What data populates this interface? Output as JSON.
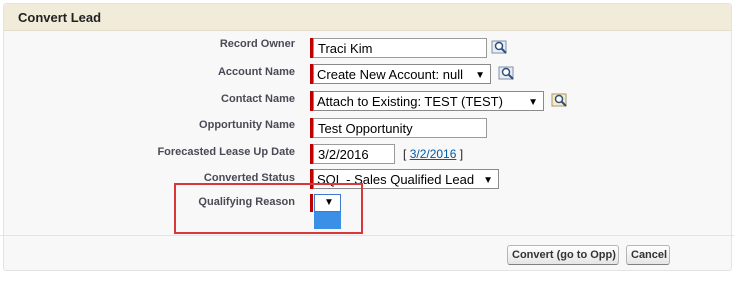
{
  "header": {
    "title": "Convert Lead"
  },
  "fields": {
    "record_owner": {
      "label": "Record Owner",
      "value": "Traci Kim"
    },
    "account_name": {
      "label": "Account Name",
      "value": "Create New Account: null"
    },
    "contact_name": {
      "label": "Contact Name",
      "value": "Attach to Existing: TEST (TEST)"
    },
    "opportunity_name": {
      "label": "Opportunity Name",
      "value": "Test Opportunity"
    },
    "forecasted_lease_up_date": {
      "label": "Forecasted Lease Up Date",
      "value": "3/2/2016",
      "link_open": "[",
      "link": "3/2/2016",
      "link_close": "]"
    },
    "converted_status": {
      "label": "Converted Status",
      "value": "SQL - Sales Qualified Lead"
    },
    "qualifying_reason": {
      "label": "Qualifying Reason",
      "value": ""
    }
  },
  "buttons": {
    "convert": "Convert (go to Opp)",
    "cancel": "Cancel"
  },
  "icons": {
    "lookup": "magnifier-lookup-icon",
    "dropdown": "chevron-down-icon"
  },
  "colors": {
    "required": "#c00000",
    "highlight": "#d9383a",
    "selection": "#3c8fe6",
    "header_bg": "#f1ebd9"
  }
}
